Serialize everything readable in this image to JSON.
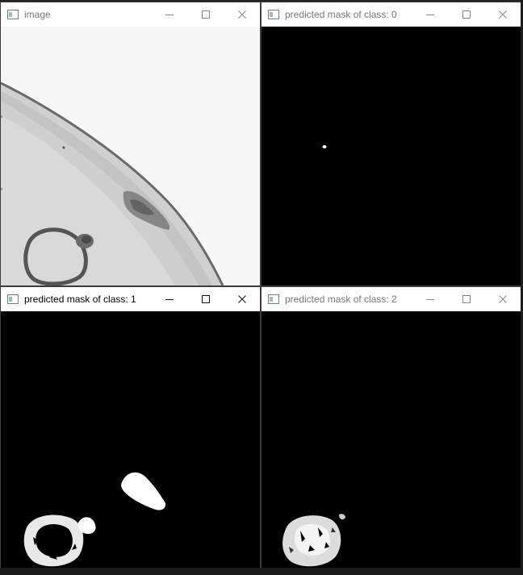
{
  "windows": [
    {
      "id": "image",
      "title": "image",
      "active": false
    },
    {
      "id": "mask0",
      "title": "predicted mask of class: 0",
      "active": false
    },
    {
      "id": "mask1",
      "title": "predicted mask of class: 1",
      "active": true
    },
    {
      "id": "mask2",
      "title": "predicted mask of class: 2",
      "active": false
    }
  ],
  "icons": {
    "app": "opencv-window-icon",
    "minimize": "minimize-icon",
    "maximize": "maximize-icon",
    "close": "close-icon"
  }
}
